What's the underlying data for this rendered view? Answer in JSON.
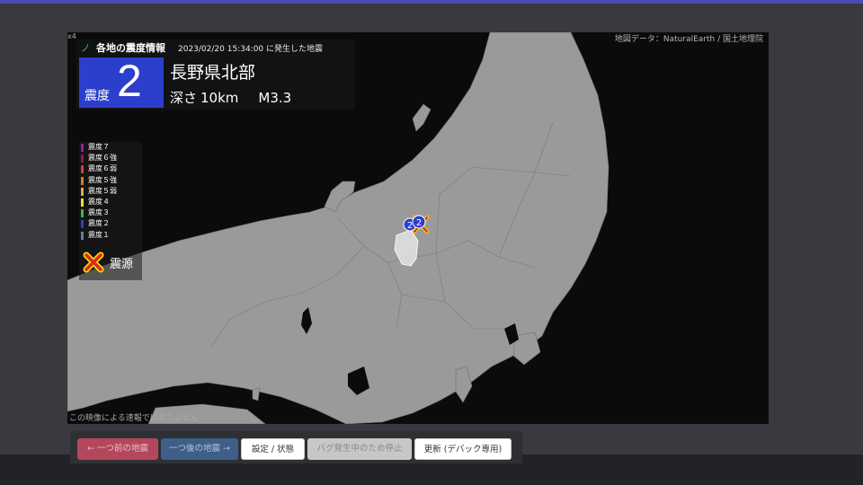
{
  "colors": {
    "intensity_2": "#2c3fcc",
    "land": "#9a9a9a",
    "sea": "#0b0b0c",
    "epicenter": "#ffd400"
  },
  "map": {
    "attribution": "地図データ：NaturalEarth / 国土地理院",
    "disclaimer": "この映像による速報ではありません",
    "corner_label": "x4"
  },
  "info": {
    "title": "各地の震度情報",
    "time": "2023/02/20 15:34:00 に発生した地震",
    "intensity_label": "震度",
    "intensity_value": "2",
    "region": "長野県北部",
    "depth_label": "深さ",
    "depth_value": "10km",
    "magnitude": "M3.3"
  },
  "legend": {
    "items": [
      {
        "label": "震度７",
        "color": "#9b1ea0"
      },
      {
        "label": "震度６強",
        "color": "#8a1e4d"
      },
      {
        "label": "震度６弱",
        "color": "#d63a3a"
      },
      {
        "label": "震度５強",
        "color": "#e0781e"
      },
      {
        "label": "震度５弱",
        "color": "#e7a93c"
      },
      {
        "label": "震度４",
        "color": "#e7e03a"
      },
      {
        "label": "震度３",
        "color": "#3bb24a"
      },
      {
        "label": "震度２",
        "color": "#2c3fcc"
      },
      {
        "label": "震度１",
        "color": "#6b7d8e"
      }
    ],
    "epicenter_label": "震源"
  },
  "stations": [
    {
      "label": "2"
    },
    {
      "label": "2"
    }
  ],
  "buttons": {
    "prev": "← 一つ前の地震",
    "next": "一つ後の地震 →",
    "settings": "設定 / 状態",
    "stop": "バグ発生中のため停止",
    "update": "更新 (デバック専用)"
  }
}
